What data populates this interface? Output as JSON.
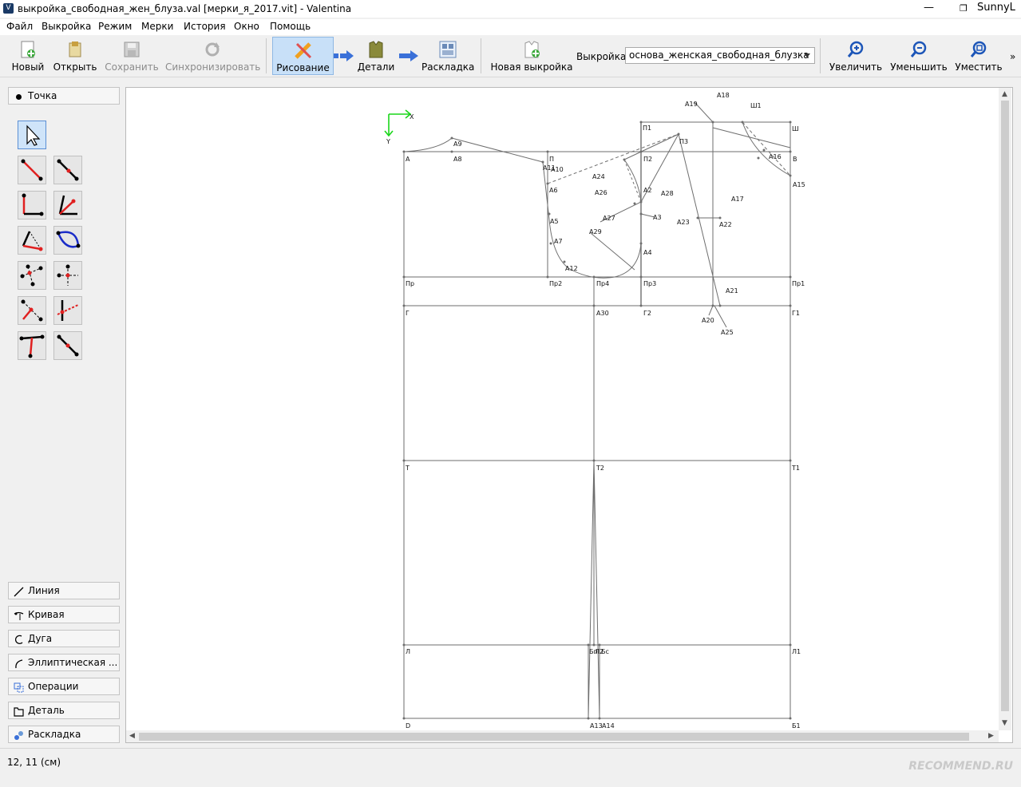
{
  "window": {
    "title": "выкройка_свободная_жен_блуза.val [мерки_я_2017.vit] - Valentina",
    "user": "SunnyL",
    "icon_label": "V"
  },
  "menu": [
    "Файл",
    "Выкройка",
    "Режим",
    "Мерки",
    "История",
    "Окно",
    "Помощь"
  ],
  "toolbar": {
    "new_label": "Новый",
    "open_label": "Открыть",
    "save_label": "Сохранить",
    "sync_label": "Синхронизировать",
    "draw_label": "Рисование",
    "details_label": "Детали",
    "layout_label": "Раскладка",
    "new_pattern_label": "Новая выкройка",
    "pattern_label": "Выкройка:",
    "pattern_value": "основа_женская_свободная_блузка",
    "zoom_in_label": "Увеличить",
    "zoom_out_label": "Уменьшить",
    "fit_label": "Уместить",
    "more_label": "»"
  },
  "sidebar": {
    "point_group": "Точка",
    "groups": [
      "Линия",
      "Кривая",
      "Дуга",
      "Эллиптическая ...",
      "Операции",
      "Деталь",
      "Раскладка"
    ]
  },
  "canvas": {
    "axis_x": "X",
    "axis_y": "Y",
    "labels": [
      "А",
      "А8",
      "А9",
      "П",
      "А11",
      "А10",
      "А6",
      "А5",
      "А7",
      "А12",
      "П1",
      "П2",
      "П3",
      "А24",
      "А26",
      "А2",
      "А28",
      "А27",
      "А3",
      "А29",
      "А4",
      "А18",
      "А19",
      "Ш1",
      "Ш",
      "В",
      "А16",
      "А15",
      "А17",
      "А23",
      "А22",
      "Пр",
      "Пр2",
      "Пр4",
      "Пр3",
      "Пр1",
      "А21",
      "А20",
      "А25",
      "Г",
      "А30",
      "Г2",
      "Г1",
      "Т",
      "Т2",
      "Т1",
      "Л",
      "Бп",
      "Л2",
      "Бс",
      "Л1",
      "D",
      "А13",
      "А14",
      "Б1"
    ]
  },
  "status": {
    "coords": "12, 11 (см)",
    "watermark": "RECOMMEND.RU"
  }
}
